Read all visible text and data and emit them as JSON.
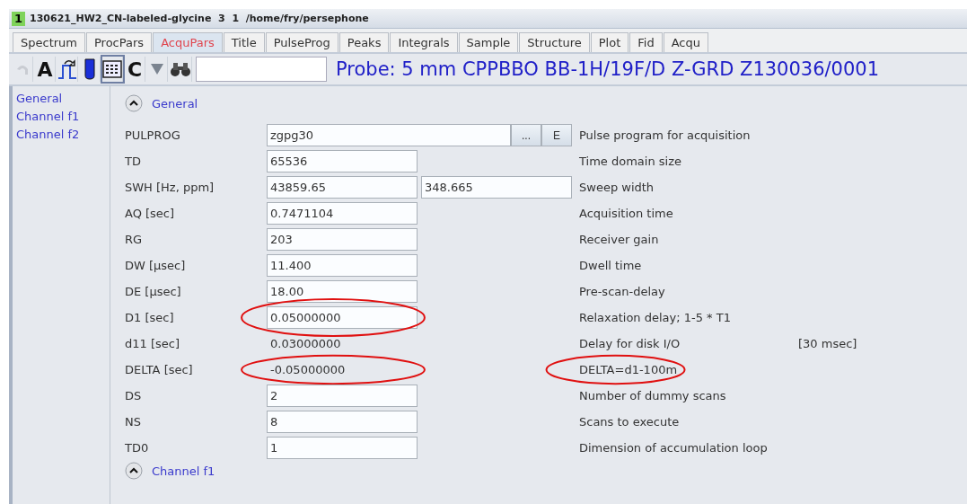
{
  "window": {
    "badge": "1",
    "title": "130621_HW2_CN-labeled-glycine  3  1  /home/fry/persephone"
  },
  "tabs": [
    {
      "label": "Spectrum",
      "selected": false
    },
    {
      "label": "ProcPars",
      "selected": false
    },
    {
      "label": "AcquPars",
      "selected": true
    },
    {
      "label": "Title",
      "selected": false
    },
    {
      "label": "PulseProg",
      "selected": false
    },
    {
      "label": "Peaks",
      "selected": false
    },
    {
      "label": "Integrals",
      "selected": false
    },
    {
      "label": "Sample",
      "selected": false
    },
    {
      "label": "Structure",
      "selected": false
    },
    {
      "label": "Plot",
      "selected": false
    },
    {
      "label": "Fid",
      "selected": false
    },
    {
      "label": "Acqu",
      "selected": false
    }
  ],
  "toolbar": {
    "letter_a": "A",
    "letter_c": "C",
    "probe": "Probe: 5 mm CPPBBO BB-1H/19F/D Z-GRD Z130036/0001"
  },
  "sidebar": {
    "items": [
      {
        "label": "General",
        "selected": false
      },
      {
        "label": "Channel f1",
        "selected": false
      },
      {
        "label": "Channel f2",
        "selected": false
      }
    ]
  },
  "sections": [
    {
      "title": "General",
      "expanded": true,
      "rows": [
        {
          "kind": "program",
          "label": "PULPROG",
          "value": "zgpg30",
          "buttons": [
            "...",
            "E"
          ],
          "description": "Pulse program for acquisition"
        },
        {
          "kind": "field",
          "label": "TD",
          "value": "65536",
          "description": "Time domain size"
        },
        {
          "kind": "pair",
          "label": "SWH [Hz, ppm]",
          "value": "43859.65",
          "value2": "348.665",
          "description": "Sweep width"
        },
        {
          "kind": "field",
          "label": "AQ [sec]",
          "value": "0.7471104",
          "description": "Acquisition time"
        },
        {
          "kind": "field",
          "label": "RG",
          "value": "203",
          "description": "Receiver gain"
        },
        {
          "kind": "field",
          "label": "DW [µsec]",
          "value": "11.400",
          "description": "Dwell time"
        },
        {
          "kind": "field",
          "label": "DE [µsec]",
          "value": "18.00",
          "description": "Pre-scan-delay"
        },
        {
          "kind": "field",
          "label": "D1 [sec]",
          "value": "0.05000000",
          "description": "Relaxation delay; 1-5 * T1",
          "value_circled": true
        },
        {
          "kind": "readonly",
          "label": "d11 [sec]",
          "value": "0.03000000",
          "description": "Delay for disk I/O",
          "note": "[30 msec]"
        },
        {
          "kind": "readonly",
          "label": "DELTA [sec]",
          "value": "-0.05000000",
          "description": "DELTA=d1-100m",
          "value_circled": true,
          "description_circled": true
        },
        {
          "kind": "field",
          "label": "DS",
          "value": "2",
          "description": "Number of dummy scans"
        },
        {
          "kind": "field",
          "label": "NS",
          "value": "8",
          "description": "Scans to execute"
        },
        {
          "kind": "field",
          "label": "TD0",
          "value": "1",
          "description": "Dimension of accumulation loop"
        }
      ]
    },
    {
      "title": "Channel f1",
      "expanded": true
    }
  ]
}
